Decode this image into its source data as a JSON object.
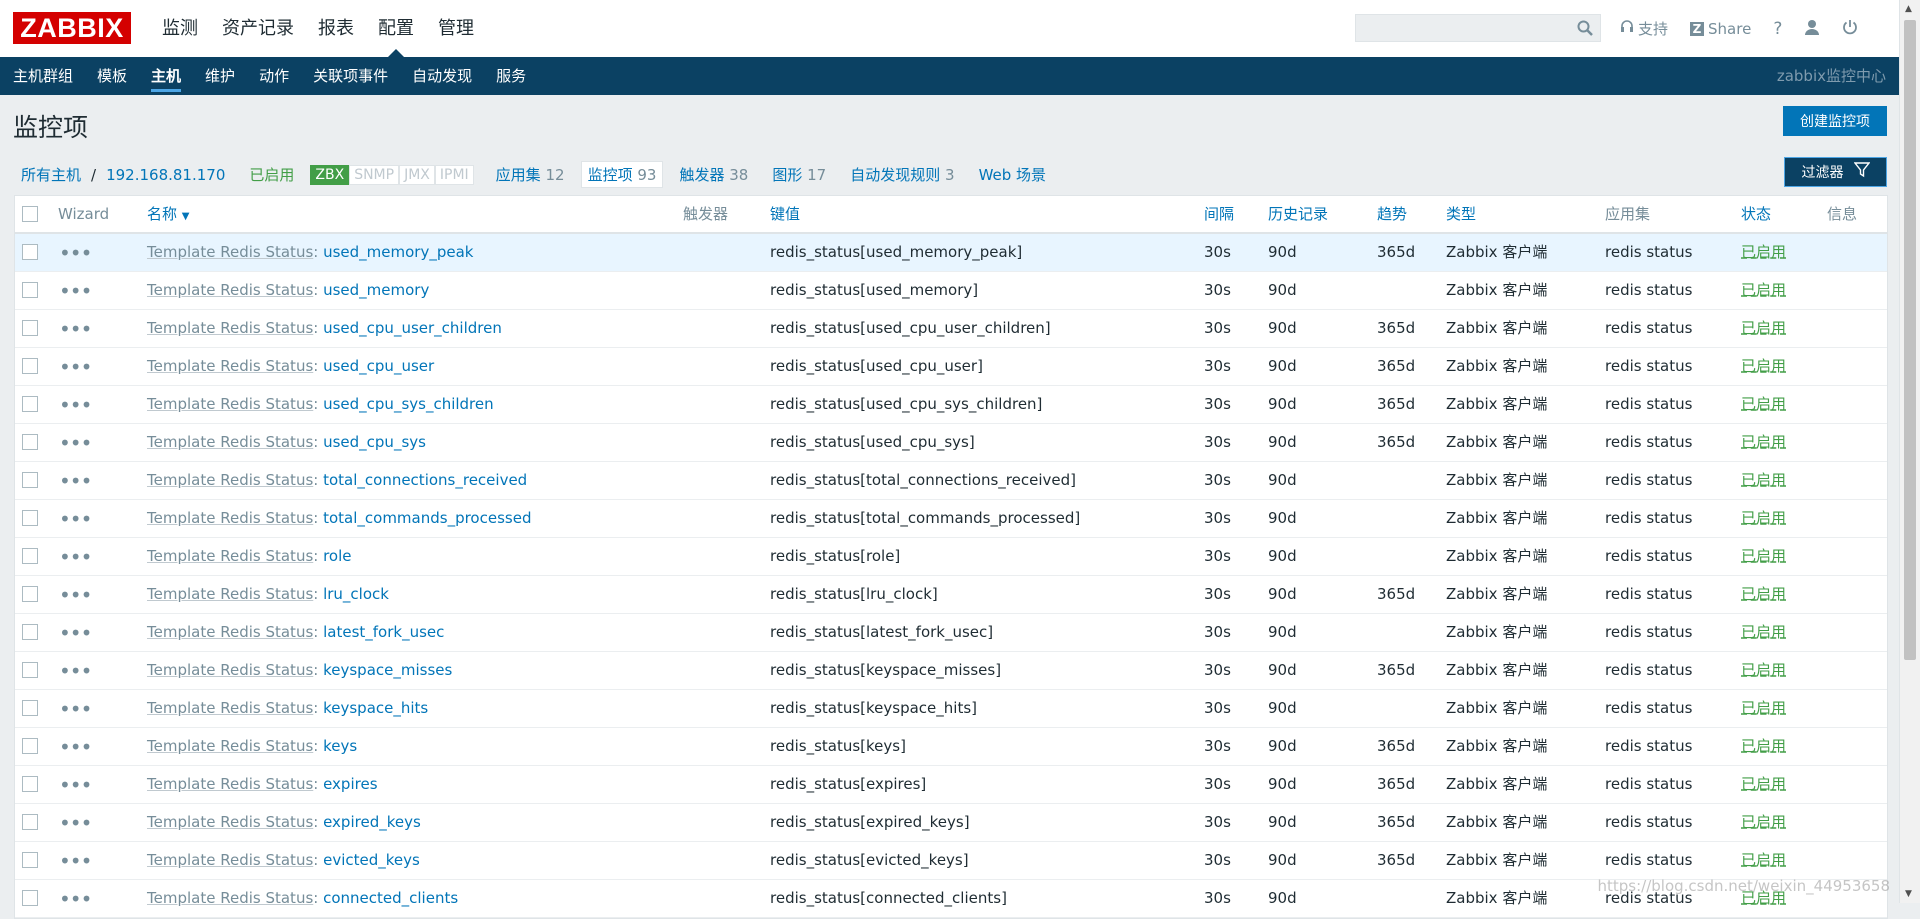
{
  "brand": {
    "logo": "ZABBIX"
  },
  "main_menu": [
    "监测",
    "资产记录",
    "报表",
    "配置",
    "管理"
  ],
  "main_menu_active": "配置",
  "search": {
    "value": "",
    "placeholder": ""
  },
  "top_right": {
    "support": "支持",
    "share": "Share",
    "help": "?"
  },
  "sub_menu": [
    "主机群组",
    "模板",
    "主机",
    "维护",
    "动作",
    "关联项事件",
    "自动发现",
    "服务"
  ],
  "sub_menu_active": "主机",
  "server_name": "zabbix监控中心",
  "page_title": "监控项",
  "create_button": "创建监控项",
  "filter_button": "过滤器",
  "breadcrumb": {
    "all_hosts": "所有主机",
    "separator": "/",
    "host": "192.168.81.170",
    "enabled": "已启用",
    "availability": [
      "ZBX",
      "SNMP",
      "JMX",
      "IPMI"
    ],
    "tabs": [
      {
        "label": "应用集",
        "count": "12"
      },
      {
        "label": "监控项",
        "count": "93"
      },
      {
        "label": "触发器",
        "count": "38"
      },
      {
        "label": "图形",
        "count": "17"
      },
      {
        "label": "自动发现规则",
        "count": "3"
      },
      {
        "label": "Web 场景",
        "count": ""
      }
    ]
  },
  "table": {
    "columns": {
      "wizard": "Wizard",
      "name": "名称",
      "name_sort": "▼",
      "triggers": "触发器",
      "key": "键值",
      "interval": "间隔",
      "history": "历史记录",
      "trends": "趋势",
      "type": "类型",
      "applications": "应用集",
      "status": "状态",
      "info": "信息"
    },
    "rows": [
      {
        "template": "Template Redis Status",
        "name": "used_memory_peak",
        "key": "redis_status[used_memory_peak]",
        "interval": "30s",
        "history": "90d",
        "trends": "365d",
        "type": "Zabbix 客户端",
        "app": "redis status",
        "status": "已启用"
      },
      {
        "template": "Template Redis Status",
        "name": "used_memory",
        "key": "redis_status[used_memory]",
        "interval": "30s",
        "history": "90d",
        "trends": "",
        "type": "Zabbix 客户端",
        "app": "redis status",
        "status": "已启用"
      },
      {
        "template": "Template Redis Status",
        "name": "used_cpu_user_children",
        "key": "redis_status[used_cpu_user_children]",
        "interval": "30s",
        "history": "90d",
        "trends": "365d",
        "type": "Zabbix 客户端",
        "app": "redis status",
        "status": "已启用"
      },
      {
        "template": "Template Redis Status",
        "name": "used_cpu_user",
        "key": "redis_status[used_cpu_user]",
        "interval": "30s",
        "history": "90d",
        "trends": "365d",
        "type": "Zabbix 客户端",
        "app": "redis status",
        "status": "已启用"
      },
      {
        "template": "Template Redis Status",
        "name": "used_cpu_sys_children",
        "key": "redis_status[used_cpu_sys_children]",
        "interval": "30s",
        "history": "90d",
        "trends": "365d",
        "type": "Zabbix 客户端",
        "app": "redis status",
        "status": "已启用"
      },
      {
        "template": "Template Redis Status",
        "name": "used_cpu_sys",
        "key": "redis_status[used_cpu_sys]",
        "interval": "30s",
        "history": "90d",
        "trends": "365d",
        "type": "Zabbix 客户端",
        "app": "redis status",
        "status": "已启用"
      },
      {
        "template": "Template Redis Status",
        "name": "total_connections_received",
        "key": "redis_status[total_connections_received]",
        "interval": "30s",
        "history": "90d",
        "trends": "",
        "type": "Zabbix 客户端",
        "app": "redis status",
        "status": "已启用"
      },
      {
        "template": "Template Redis Status",
        "name": "total_commands_processed",
        "key": "redis_status[total_commands_processed]",
        "interval": "30s",
        "history": "90d",
        "trends": "",
        "type": "Zabbix 客户端",
        "app": "redis status",
        "status": "已启用"
      },
      {
        "template": "Template Redis Status",
        "name": "role",
        "key": "redis_status[role]",
        "interval": "30s",
        "history": "90d",
        "trends": "",
        "type": "Zabbix 客户端",
        "app": "redis status",
        "status": "已启用"
      },
      {
        "template": "Template Redis Status",
        "name": "lru_clock",
        "key": "redis_status[lru_clock]",
        "interval": "30s",
        "history": "90d",
        "trends": "365d",
        "type": "Zabbix 客户端",
        "app": "redis status",
        "status": "已启用"
      },
      {
        "template": "Template Redis Status",
        "name": "latest_fork_usec",
        "key": "redis_status[latest_fork_usec]",
        "interval": "30s",
        "history": "90d",
        "trends": "",
        "type": "Zabbix 客户端",
        "app": "redis status",
        "status": "已启用"
      },
      {
        "template": "Template Redis Status",
        "name": "keyspace_misses",
        "key": "redis_status[keyspace_misses]",
        "interval": "30s",
        "history": "90d",
        "trends": "365d",
        "type": "Zabbix 客户端",
        "app": "redis status",
        "status": "已启用"
      },
      {
        "template": "Template Redis Status",
        "name": "keyspace_hits",
        "key": "redis_status[keyspace_hits]",
        "interval": "30s",
        "history": "90d",
        "trends": "",
        "type": "Zabbix 客户端",
        "app": "redis status",
        "status": "已启用"
      },
      {
        "template": "Template Redis Status",
        "name": "keys",
        "key": "redis_status[keys]",
        "interval": "30s",
        "history": "90d",
        "trends": "365d",
        "type": "Zabbix 客户端",
        "app": "redis status",
        "status": "已启用"
      },
      {
        "template": "Template Redis Status",
        "name": "expires",
        "key": "redis_status[expires]",
        "interval": "30s",
        "history": "90d",
        "trends": "365d",
        "type": "Zabbix 客户端",
        "app": "redis status",
        "status": "已启用"
      },
      {
        "template": "Template Redis Status",
        "name": "expired_keys",
        "key": "redis_status[expired_keys]",
        "interval": "30s",
        "history": "90d",
        "trends": "365d",
        "type": "Zabbix 客户端",
        "app": "redis status",
        "status": "已启用"
      },
      {
        "template": "Template Redis Status",
        "name": "evicted_keys",
        "key": "redis_status[evicted_keys]",
        "interval": "30s",
        "history": "90d",
        "trends": "365d",
        "type": "Zabbix 客户端",
        "app": "redis status",
        "status": "已启用"
      },
      {
        "template": "Template Redis Status",
        "name": "connected_clients",
        "key": "redis_status[connected_clients]",
        "interval": "30s",
        "history": "90d",
        "trends": "",
        "type": "Zabbix 客户端",
        "app": "redis status",
        "status": "已启用"
      }
    ]
  },
  "watermark": "https://blog.csdn.net/weixin_44953658",
  "colors": {
    "brand_red": "#d40000",
    "nav_blue": "#0b4163",
    "link": "#0275b8",
    "enabled_green": "#429e47"
  }
}
